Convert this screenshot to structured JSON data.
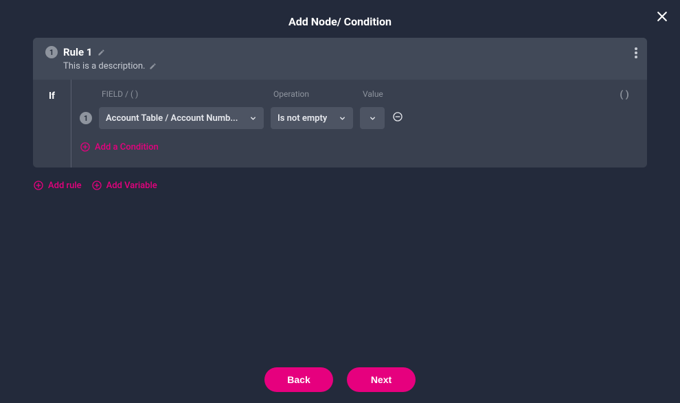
{
  "modal": {
    "title": "Add Node/ Condition"
  },
  "rule": {
    "number": "1",
    "title": "Rule 1",
    "description": "This is a description."
  },
  "headers": {
    "field": "FIELD / ( )",
    "operation": "Operation",
    "value": "Value",
    "paren": "( )"
  },
  "condition": {
    "if_label": "If",
    "number": "1",
    "field": "Account Table / Account Numb...",
    "operation": "Is not empty"
  },
  "actions": {
    "add_condition": "Add a Condition",
    "add_rule": "Add rule",
    "add_variable": "Add Variable"
  },
  "footer": {
    "back": "Back",
    "next": "Next"
  }
}
